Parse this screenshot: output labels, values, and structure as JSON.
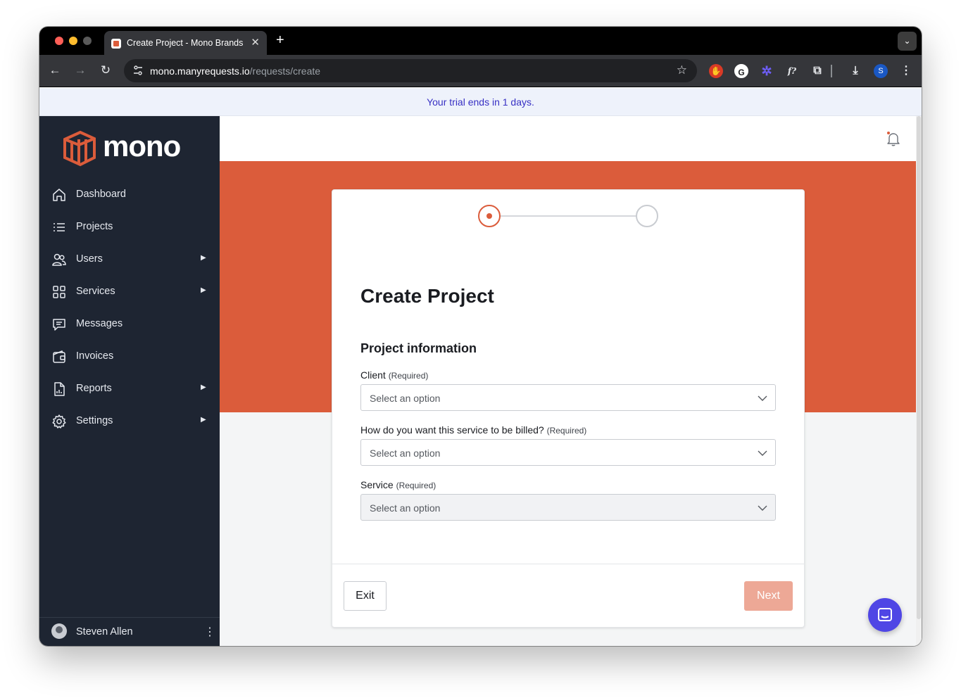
{
  "browser": {
    "tab_title": "Create Project - Mono Brands",
    "url_host": "mono.manyrequests.io",
    "url_path": "/requests/create",
    "profile_initial": "S"
  },
  "banner": {
    "text": "Your trial ends in 1 days."
  },
  "brand": {
    "name": "mono",
    "accent": "#db5c3b"
  },
  "sidebar": {
    "items": [
      {
        "label": "Dashboard",
        "icon": "home-icon",
        "has_submenu": false
      },
      {
        "label": "Projects",
        "icon": "list-icon",
        "has_submenu": false
      },
      {
        "label": "Users",
        "icon": "users-icon",
        "has_submenu": true
      },
      {
        "label": "Services",
        "icon": "grid-icon",
        "has_submenu": true
      },
      {
        "label": "Messages",
        "icon": "message-icon",
        "has_submenu": false
      },
      {
        "label": "Invoices",
        "icon": "wallet-icon",
        "has_submenu": false
      },
      {
        "label": "Reports",
        "icon": "report-icon",
        "has_submenu": true
      },
      {
        "label": "Settings",
        "icon": "gear-icon",
        "has_submenu": true
      }
    ],
    "user": {
      "name": "Steven Allen"
    }
  },
  "form": {
    "title": "Create Project",
    "section": "Project information",
    "fields": [
      {
        "label": "Client",
        "required": "(Required)",
        "placeholder": "Select an option",
        "disabled": false
      },
      {
        "label": "How do you want this service to be billed?",
        "required": "(Required)",
        "placeholder": "Select an option",
        "disabled": false
      },
      {
        "label": "Service",
        "required": "(Required)",
        "placeholder": "Select an option",
        "disabled": true
      }
    ],
    "exit_label": "Exit",
    "next_label": "Next"
  }
}
